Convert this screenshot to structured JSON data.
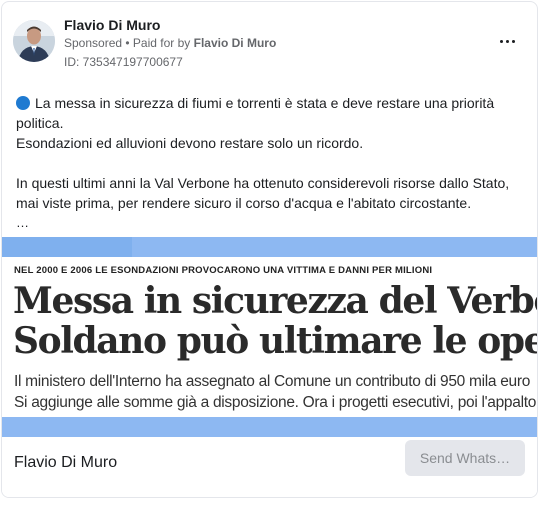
{
  "header": {
    "name": "Flavio Di Muro",
    "sponsored_label": "Sponsored",
    "separator": " • ",
    "paid_for_prefix": "Paid for by ",
    "paid_for_name": "Flavio Di Muro",
    "ad_id": "ID: 735347197700677",
    "more_icon": "more-options-icon"
  },
  "post": {
    "line1": "La messa in sicurezza di fiumi e torrenti è stata e deve restare una priorità",
    "line2": "politica.",
    "line3": "Esondazioni ed alluvioni devono restare solo un ricordo.",
    "line4": "In questi ultimi anni la Val Verbone ha ottenuto considerevoli risorse dallo Stato,",
    "line5": "mai viste prima, per rendere sicuro il corso d'acqua e l'abitato circostante.",
    "truncation": "…",
    "bullet_color": "#1f7ad1"
  },
  "creative": {
    "kicker": "NEL 2000 E 2006 LE ESONDAZIONI PROVOCARONO UNA VITTIMA E DANNI PER MILIONI",
    "headline1": "Messa in sicurezza del Verbone",
    "headline2": "Soldano può ultimare le opere",
    "subhead1": "Il ministero dell'Interno ha assegnato al Comune un contributo di 950 mila euro",
    "subhead2": "Si aggiunge alle somme già a disposizione. Ora i progetti esecutivi, poi l'appalto",
    "band_color": "#8db8f2"
  },
  "footer": {
    "name": "Flavio Di Muro",
    "cta_label": "Send Whats…"
  }
}
